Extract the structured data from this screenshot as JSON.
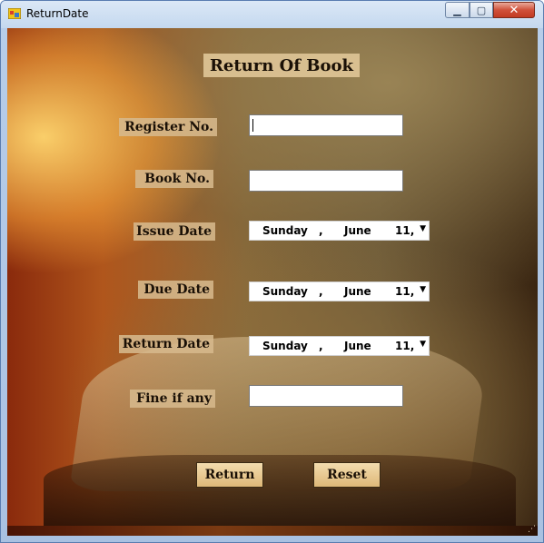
{
  "window": {
    "title": "ReturnDate",
    "app_icon": "form-icon",
    "controls": {
      "minimize": "minimize-icon",
      "maximize": "maximize-icon",
      "close": "close-icon"
    }
  },
  "form": {
    "heading": "Return Of Book",
    "labels": {
      "register_no": "Register No.",
      "book_no": "Book No.",
      "issue_date": "Issue Date",
      "due_date": "Due Date",
      "return_date": "Return Date",
      "fine": "Fine if any"
    },
    "inputs": {
      "register_no": "",
      "book_no": "",
      "fine": ""
    },
    "issue_date": {
      "day": "Sunday",
      "sep": ",",
      "month": "June",
      "date": "11,",
      "arrow": "▼"
    },
    "due_date": {
      "day": "Sunday",
      "sep": ",",
      "month": "June",
      "date": "11,",
      "arrow": "▼"
    },
    "return_date": {
      "day": "Sunday",
      "sep": ",",
      "month": "June",
      "date": "11,",
      "arrow": "▼"
    },
    "buttons": {
      "return": "Return",
      "reset": "Reset"
    }
  },
  "colors": {
    "label_bg": "#d6b88c",
    "button_bg": "#e8c68a",
    "close_button": "#c23b22"
  }
}
